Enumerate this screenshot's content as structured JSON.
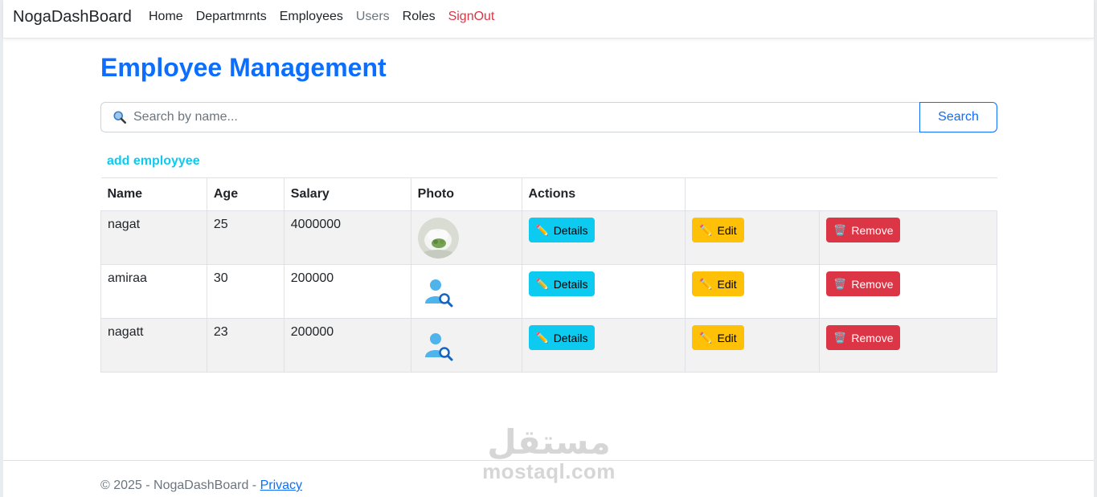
{
  "navbar": {
    "brand": "NogaDashBoard",
    "links": [
      {
        "label": "Home"
      },
      {
        "label": "Departmrnts"
      },
      {
        "label": "Employees"
      },
      {
        "label": "Users"
      },
      {
        "label": "Roles"
      },
      {
        "label": "SignOut"
      }
    ]
  },
  "page": {
    "title": "Employee Management",
    "search": {
      "placeholder": "Search by name...",
      "value": "",
      "button_label": "Search",
      "icon": "magnifier-icon"
    },
    "add_link": "add employyee"
  },
  "table": {
    "headers": [
      "Name",
      "Age",
      "Salary",
      "Photo",
      "Actions"
    ],
    "rows": [
      {
        "name": "nagat",
        "age": "25",
        "salary": "4000000",
        "photo": "photo-avatar"
      },
      {
        "name": "amiraa",
        "age": "30",
        "salary": "200000",
        "photo": "default-user-icon"
      },
      {
        "name": "nagatt",
        "age": "23",
        "salary": "200000",
        "photo": "default-user-icon"
      }
    ],
    "actions": {
      "details": {
        "label": "Details",
        "icon": "✏️"
      },
      "edit": {
        "label": "Edit",
        "icon": "✏️"
      },
      "remove": {
        "label": "Remove",
        "icon": "🗑️"
      }
    }
  },
  "footer": {
    "copyright": "© 2025 - NogaDashBoard - ",
    "privacy_link": "Privacy"
  },
  "watermark": {
    "arabic": "مستقل",
    "latin": "mostaql.com"
  },
  "colors": {
    "primary": "#0d6efd",
    "info": "#0dcaf0",
    "warning": "#ffc107",
    "danger": "#dc3545"
  }
}
